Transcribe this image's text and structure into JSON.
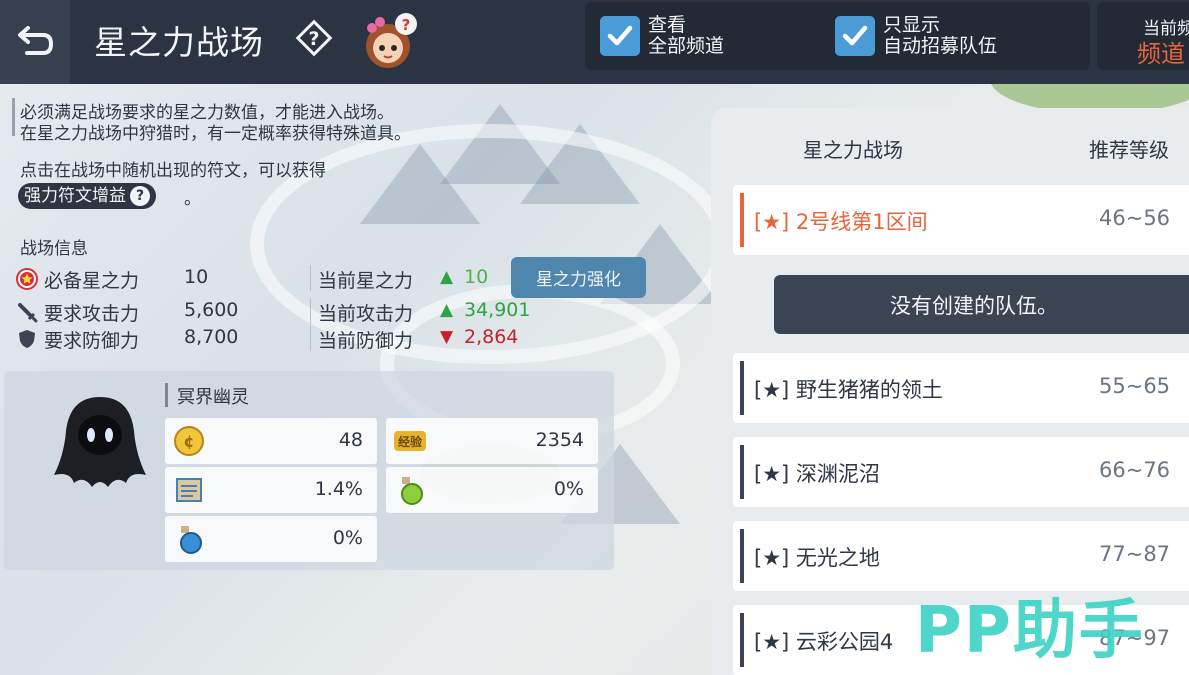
{
  "header": {
    "title": "星之力战场",
    "filters": [
      {
        "line1": "查看",
        "line2": "全部频道",
        "checked": true
      },
      {
        "line1": "只显示",
        "line2": "自动招募队伍",
        "checked": true
      }
    ],
    "channel": {
      "label": "当前频",
      "value": "频道"
    }
  },
  "description": {
    "line1": "必须满足战场要求的星之力数值，才能进入战场。",
    "line2": "在星之力战场中狩猎时，有一定概率获得特殊道具。",
    "line3": "点击在战场中随机出现的符文，可以获得",
    "buff_label": "强力符文增益",
    "buff_suffix": "。"
  },
  "field_info": {
    "title": "战场信息",
    "rows": [
      {
        "label": "必备星之力",
        "value": "10",
        "current_label": "当前星之力",
        "current_value": "10",
        "trend": "up"
      },
      {
        "label": "要求攻击力",
        "value": "5,600",
        "current_label": "当前攻击力",
        "current_value": "34,901",
        "trend": "up"
      },
      {
        "label": "要求防御力",
        "value": "8,700",
        "current_label": "当前防御力",
        "current_value": "2,864",
        "trend": "down"
      }
    ],
    "enhance_button": "星之力强化"
  },
  "monster": {
    "name": "冥界幽灵",
    "stats": [
      {
        "icon": "meso-coin-icon",
        "value": "48"
      },
      {
        "icon": "exp-icon",
        "icon_text": "经验",
        "value": "2354"
      },
      {
        "icon": "scroll-icon",
        "value": "1.4%"
      },
      {
        "icon": "green-potion-icon",
        "value": "0%"
      },
      {
        "icon": "blue-potion-icon",
        "value": "0%"
      }
    ]
  },
  "list": {
    "col_name": "星之力战场",
    "col_level": "推荐等级",
    "no_party": "没有创建的队伍。",
    "items": [
      {
        "name": "[★] 2号线第1区间",
        "level": "46~56",
        "selected": true
      },
      {
        "name": "[★] 野生猪猪的领土",
        "level": "55~65",
        "selected": false
      },
      {
        "name": "[★] 深渊泥沼",
        "level": "66~76",
        "selected": false
      },
      {
        "name": "[★] 无光之地",
        "level": "77~87",
        "selected": false
      },
      {
        "name": "[★] 云彩公园4",
        "level": "87~97",
        "selected": false
      }
    ]
  },
  "watermark": "PP助手",
  "colors": {
    "accent": "#e8643a",
    "topbar": "#2b3442",
    "checkbox": "#4b9bd6",
    "up": "#2ea343",
    "down": "#c8202a",
    "watermark": "#3fd3c6"
  }
}
